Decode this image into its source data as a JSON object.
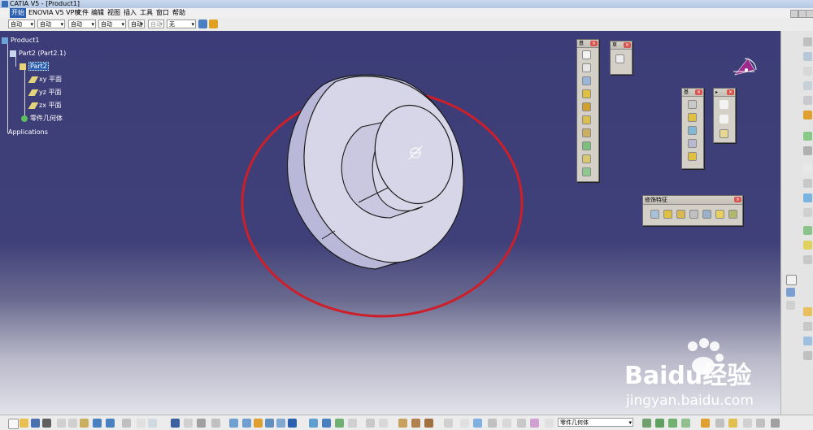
{
  "window": {
    "title": "CATIA V5 - [Product1]"
  },
  "menu": {
    "items": [
      "开始",
      "ENOVIA V5 VPM",
      "文件",
      "编辑",
      "视图",
      "插入",
      "工具",
      "窗口",
      "帮助"
    ]
  },
  "toolbar": {
    "dropdowns": [
      "自动",
      "自动",
      "自动",
      "自动",
      "自动",
      "自动",
      "自动",
      "无"
    ]
  },
  "tree": {
    "product": "Product1",
    "part_instance": "Part2 (Part2.1)",
    "part": "Part2",
    "planes": [
      "xy 平面",
      "yz 平面",
      "zx 平面"
    ],
    "body": "零件几何体",
    "applications": "Applications"
  },
  "panels": {
    "decorative_features": "修饰特征",
    "toolbar_a": "基",
    "toolbar_b": "草",
    "toolbar_c": "基"
  },
  "statusbar": {
    "command_value": "零件几何体"
  },
  "watermark": {
    "brand": "Baidu经验",
    "url": "jingyan.baidu.com"
  },
  "colors": {
    "viewport_top": "#3c3d78",
    "annotation_circle": "#cc1f2a",
    "part_face": "#d7d6e8"
  }
}
